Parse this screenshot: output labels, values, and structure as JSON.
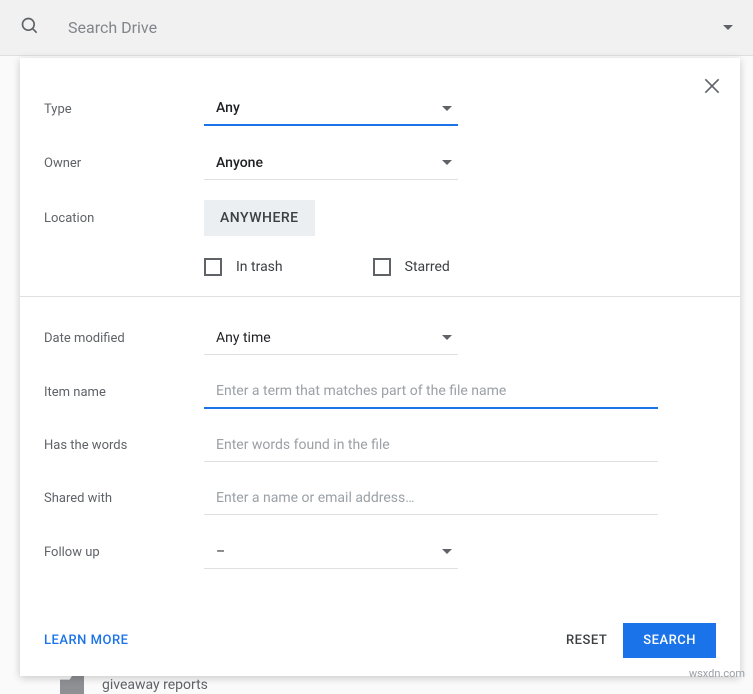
{
  "search": {
    "placeholder": "Search Drive"
  },
  "panel": {
    "labels": {
      "type": "Type",
      "owner": "Owner",
      "location": "Location",
      "date_modified": "Date modified",
      "item_name": "Item name",
      "has_words": "Has the words",
      "shared_with": "Shared with",
      "follow_up": "Follow up"
    },
    "type_value": "Any",
    "owner_value": "Anyone",
    "location_button": "ANYWHERE",
    "check_trash": "In trash",
    "check_starred": "Starred",
    "date_value": "Any time",
    "item_name_placeholder": "Enter a term that matches part of the file name",
    "has_words_placeholder": "Enter words found in the file",
    "shared_with_placeholder": "Enter a name or email address…",
    "followup_value": "–"
  },
  "footer": {
    "learn": "LEARN MORE",
    "reset": "RESET",
    "search": "SEARCH"
  },
  "bg_item": "giveaway reports",
  "watermark": "wsxdn.com"
}
